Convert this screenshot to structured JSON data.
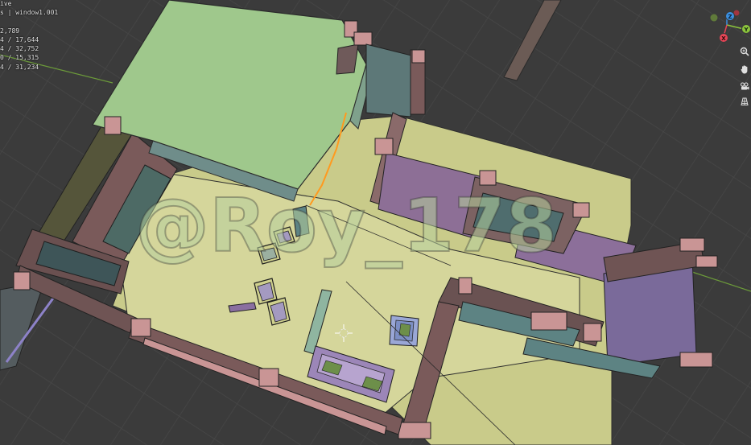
{
  "overlay": {
    "mode_fragment": "ive",
    "collection_fragment": "s | window1.001",
    "stats": [
      "2,789",
      "4 / 17,644",
      "4 / 32,752",
      "0 / 15,315",
      "4 / 31,234"
    ]
  },
  "watermark": "@Roy_178",
  "gizmo": {
    "z_label": "Z",
    "y_label": "Y",
    "x_label": "X"
  },
  "colors": {
    "background": "#3b3b3b",
    "grid": "#484848",
    "floor": "#cfd08e",
    "roof": "#99c58a",
    "wall_brown": "#7a5a5a",
    "wall_pink": "#c99595",
    "window_purple": "#8c73a8",
    "window_teal": "#5f8787",
    "selection_orange": "#ff9a1f",
    "axis_x": "#e64556",
    "axis_y": "#8cc43c",
    "axis_z": "#3a8fe0"
  },
  "nav_icons": [
    "zoom-icon",
    "hand-pan-icon",
    "camera-icon",
    "ortho-grid-icon"
  ]
}
